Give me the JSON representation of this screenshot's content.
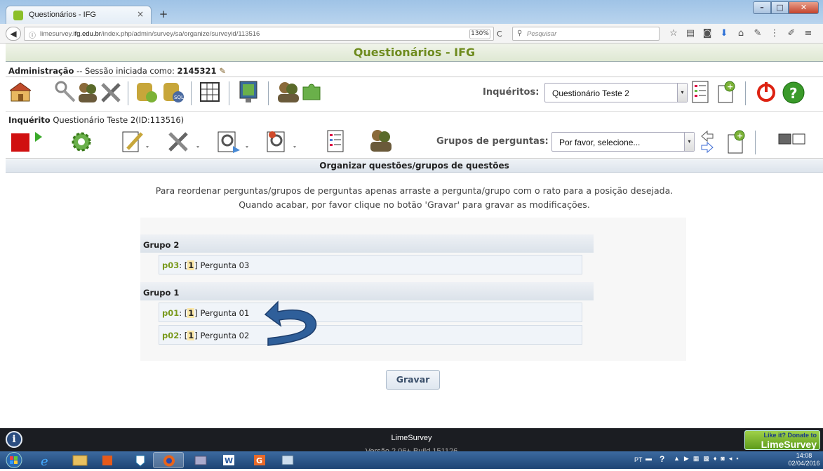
{
  "browser": {
    "tab_title": "Questionários - IFG",
    "url_prefix": "limesurvey.",
    "url_host": "ifg.edu.br",
    "url_path": "/index.php/admin/survey/sa/organize/surveyid/113516",
    "zoom": "130%",
    "search_placeholder": "Pesquisar"
  },
  "app": {
    "header_title": "Questionários - IFG",
    "admin_label": "Administração",
    "session_text": " -- Sessão iniciada como: ",
    "session_user": "2145321",
    "surveys_label": "Inquéritos:",
    "surveys_selected": "Questionário Teste 2",
    "survey_label": "Inquérito",
    "survey_name": " Questionário Teste 2(ID:113516)",
    "groups_label": "Grupos de perguntas:",
    "groups_selected": "Por favor, selecione...",
    "page_subtitle": "Organizar questões/grupos de questões"
  },
  "instructions": {
    "line1": "Para reordenar perguntas/grupos de perguntas apenas arraste a pergunta/grupo com o rato para a posição desejada.",
    "line2": "Quando acabar, por favor clique no botão 'Gravar' para gravar as modificações."
  },
  "groups": [
    {
      "name": "Grupo 2",
      "questions": [
        {
          "code": "p03",
          "num": "1",
          "text": " Pergunta 03"
        }
      ]
    },
    {
      "name": "Grupo 1",
      "questions": [
        {
          "code": "p01",
          "num": "1",
          "text": " Pergunta 01"
        },
        {
          "code": "p02",
          "num": "1",
          "text": " Pergunta 02"
        }
      ]
    }
  ],
  "save_label": "Gravar",
  "footer": {
    "app_name": "LimeSurvey",
    "version": "Versão 2.06+ Build 151126",
    "donate_line1": "Like it? Donate to",
    "donate_line2": "LimeSurvey"
  },
  "taskbar": {
    "lang": "PT",
    "time": "14:08",
    "date": "02/04/2016"
  },
  "colors": {
    "brand_green": "#6e8b1e",
    "question_code": "#7a9a1e",
    "arrow_blue": "#2f5f9a"
  }
}
